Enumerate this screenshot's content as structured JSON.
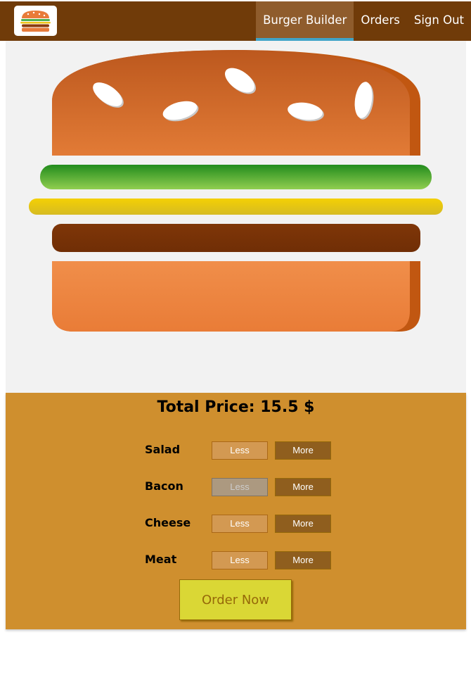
{
  "toolbar": {
    "nav": [
      {
        "label": "Burger Builder",
        "active": true
      },
      {
        "label": "Orders",
        "active": false
      },
      {
        "label": "Sign Out",
        "active": false
      }
    ]
  },
  "build_controls": {
    "price_label": "Total Price:",
    "price_value": "15.5",
    "currency": "$",
    "controls": [
      {
        "label": "Salad",
        "less": "Less",
        "more": "More",
        "less_disabled": false
      },
      {
        "label": "Bacon",
        "less": "Less",
        "more": "More",
        "less_disabled": true
      },
      {
        "label": "Cheese",
        "less": "Less",
        "more": "More",
        "less_disabled": false
      },
      {
        "label": "Meat",
        "less": "Less",
        "more": "More",
        "less_disabled": false
      }
    ],
    "order_button": "Order Now"
  },
  "colors": {
    "toolbar": "#703B09",
    "active_underline": "#40A4C8",
    "controls_bg": "#CF8F2E",
    "order_button": "#DAD735"
  }
}
